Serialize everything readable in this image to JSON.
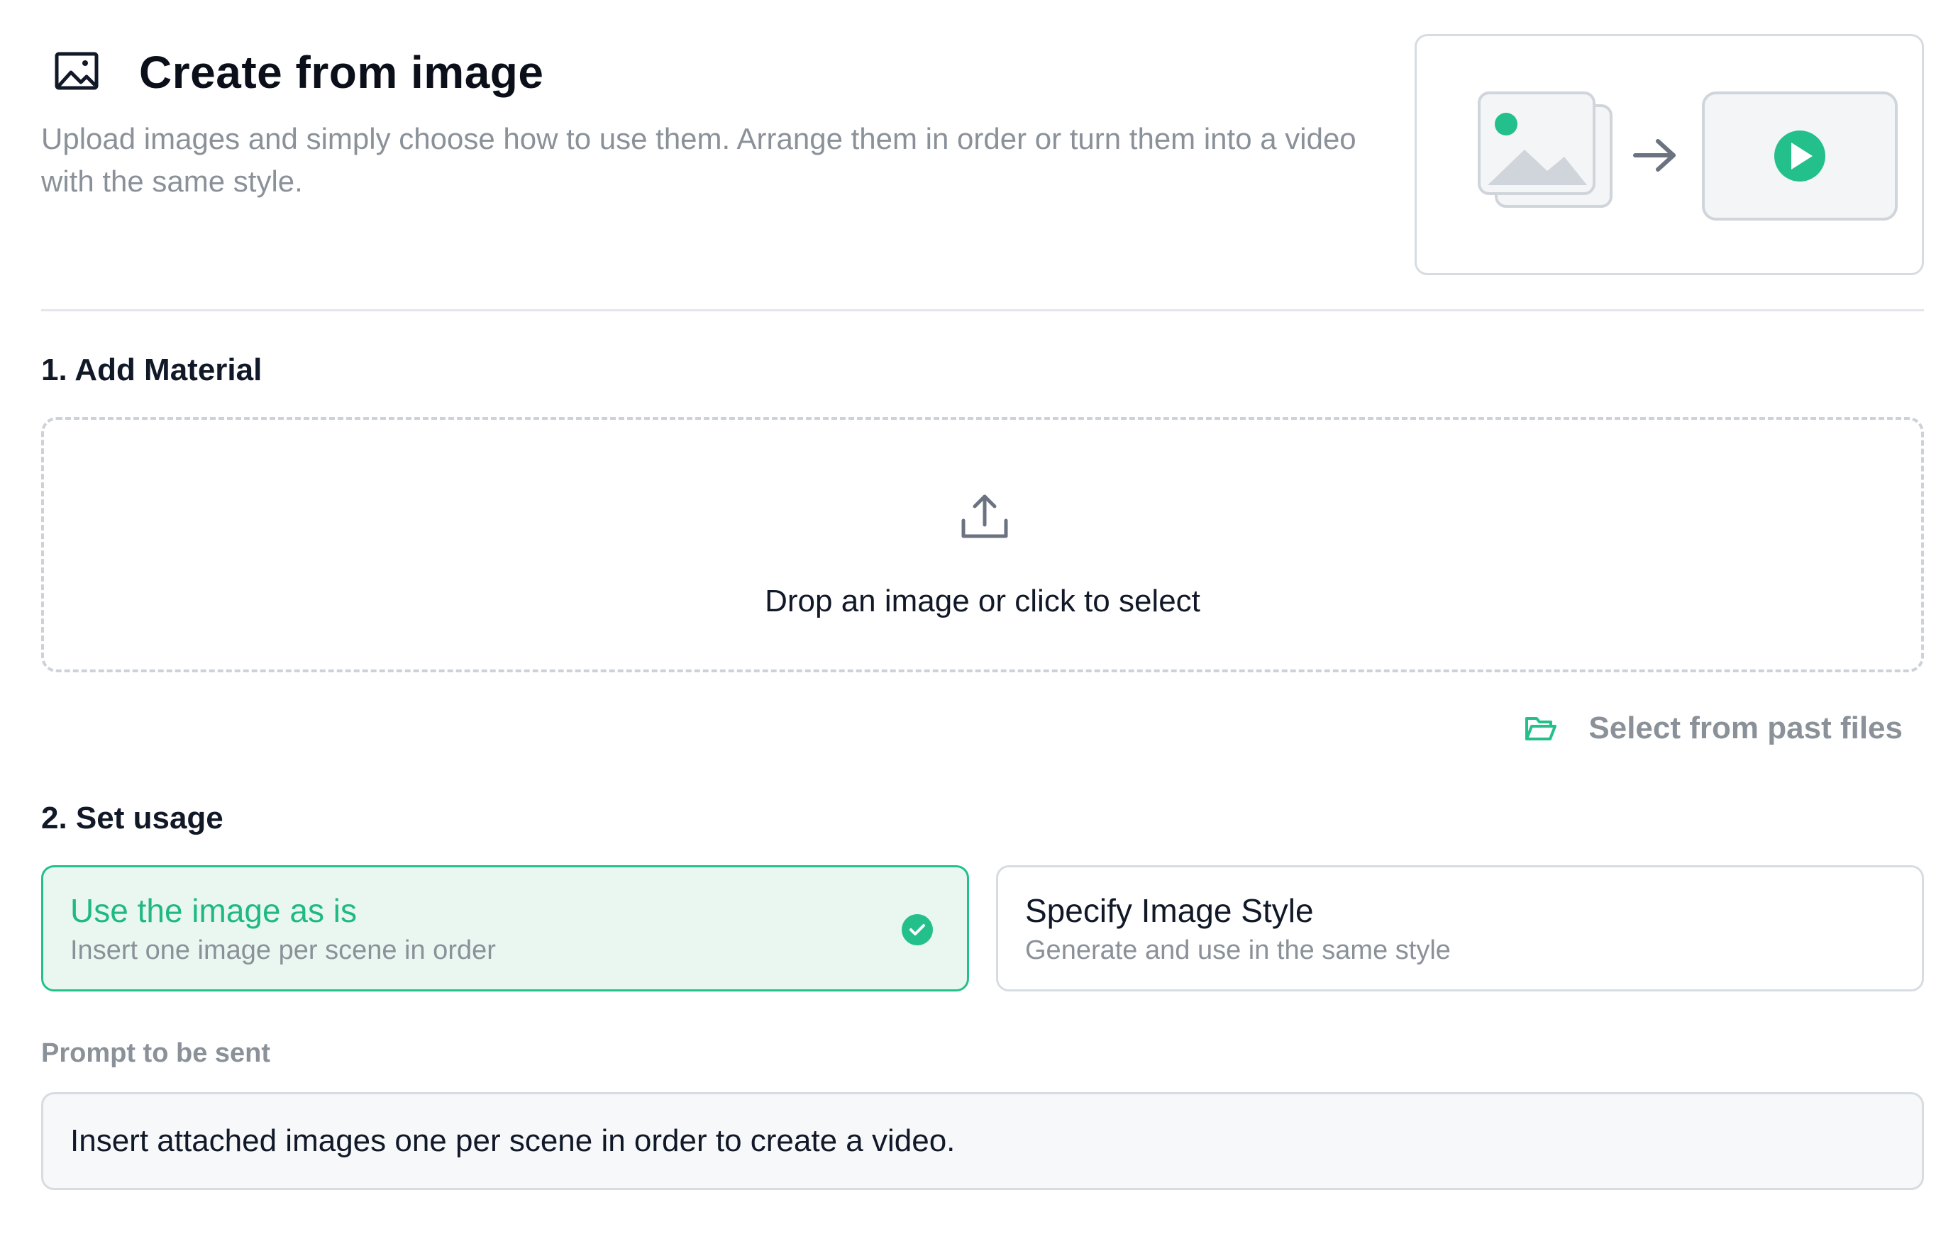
{
  "header": {
    "title": "Create from image",
    "description": "Upload images and simply choose how to use them. Arrange them in order or turn them into a video with the same style.",
    "icon": "image-icon",
    "preview": {
      "source_icon": "image-stack-icon",
      "arrow_icon": "arrow-right-icon",
      "target_icon": "play-video-icon"
    }
  },
  "section_material": {
    "title": "1. Add Material",
    "dropzone_text": "Drop an image or click to select",
    "upload_icon": "upload-icon",
    "past_files_label": "Select from past files",
    "past_files_icon": "folder-open-icon"
  },
  "section_usage": {
    "title": "2. Set usage",
    "options": [
      {
        "title": "Use the image as is",
        "subtitle": "Insert one image per scene in order",
        "selected": true
      },
      {
        "title": "Specify Image Style",
        "subtitle": "Generate and use in the same style",
        "selected": false
      }
    ],
    "prompt_label": "Prompt to be sent",
    "prompt_value": "Insert attached images one per scene in order to create a video."
  },
  "colors": {
    "accent": "#24c08b",
    "accent_text": "#1fb982",
    "selected_bg": "#eaf7f1",
    "muted_text": "#8a9199",
    "border": "#d7dce1"
  }
}
